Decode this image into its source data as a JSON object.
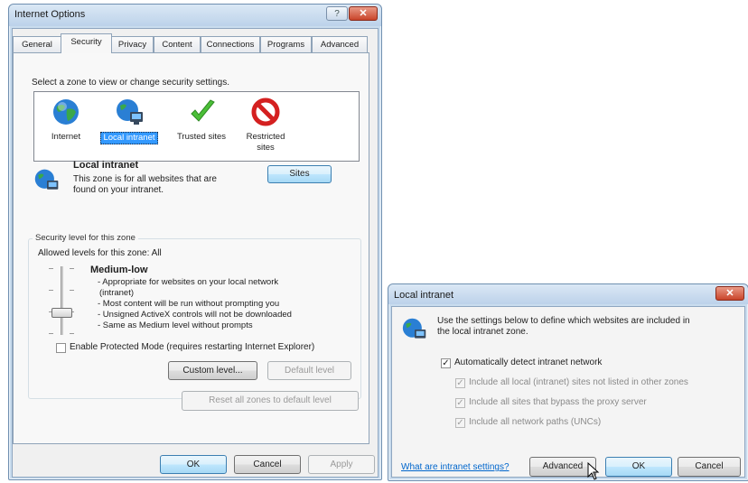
{
  "internet_options": {
    "title": "Internet Options",
    "help_btn": "?",
    "close_btn": "✕",
    "tabs": [
      "General",
      "Security",
      "Privacy",
      "Content",
      "Connections",
      "Programs",
      "Advanced"
    ],
    "select_zone_text": "Select a zone to view or change security settings.",
    "zones": [
      {
        "label": "Internet",
        "icon": "globe-icon"
      },
      {
        "label": "Local intranet",
        "icon": "intranet-icon"
      },
      {
        "label": "Trusted sites",
        "icon": "checkmark-icon"
      },
      {
        "label": "Restricted sites",
        "icon": "restricted-icon"
      }
    ],
    "zone_title": "Local intranet",
    "zone_desc_line1": "This zone is for all websites that are",
    "zone_desc_line2": "found on your intranet.",
    "sites_btn": "Sites",
    "security_level_group": "Security level for this zone",
    "allowed_levels": "Allowed levels for this zone: All",
    "level_name": "Medium-low",
    "level_desc": [
      "- Appropriate for websites on your local network",
      "(intranet)",
      "- Most content will be run without prompting you",
      "- Unsigned ActiveX controls will not be downloaded",
      "- Same as Medium level without prompts"
    ],
    "protected_mode": "Enable Protected Mode (requires restarting Internet Explorer)",
    "custom_level_btn": "Custom level...",
    "default_level_btn": "Default level",
    "reset_all_btn": "Reset all zones to default level",
    "ok_btn": "OK",
    "cancel_btn": "Cancel",
    "apply_btn": "Apply"
  },
  "local_intranet": {
    "title": "Local intranet",
    "close_btn": "✕",
    "intro_line1": "Use the settings below to define which websites are included in",
    "intro_line2": "the local intranet zone.",
    "auto_detect": "Automatically detect intranet network",
    "options": [
      "Include all local (intranet) sites not listed in other zones",
      "Include all sites that bypass the proxy server",
      "Include all network paths (UNCs)"
    ],
    "help_link": "What are intranet settings?",
    "advanced_btn": "Advanced",
    "ok_btn": "OK",
    "cancel_btn": "Cancel"
  },
  "colors": {
    "title_gradient_top": "#dbe8f5",
    "selection": "#3399ff",
    "link": "#0066cc",
    "close_red": "#c9442a"
  }
}
